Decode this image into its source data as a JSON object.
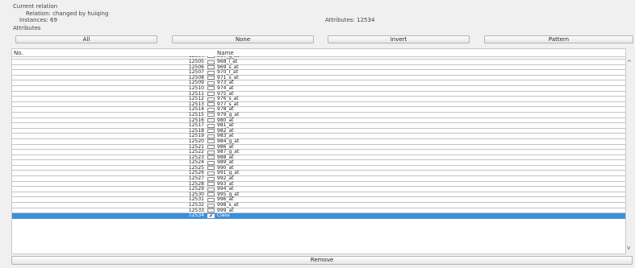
{
  "current_relation": {
    "heading": "Current relation",
    "relation": "Relation: changed by huiqing",
    "instances": "Instances: 69",
    "attributes_count": "Attributes: 12534"
  },
  "attributes_section": {
    "heading": "Attributes",
    "buttons": {
      "all": "All",
      "none": "None",
      "invert": "Invert",
      "pattern": "Pattern"
    }
  },
  "table": {
    "columns": [
      "No.",
      "Name"
    ],
    "partial_top_row": {
      "no": "12504",
      "name": "967_g_at"
    },
    "rows": [
      {
        "no": "12505",
        "name": "968_i_at"
      },
      {
        "no": "12506",
        "name": "969_s_at"
      },
      {
        "no": "12507",
        "name": "970_r_at"
      },
      {
        "no": "12508",
        "name": "971_s_at"
      },
      {
        "no": "12509",
        "name": "973_at"
      },
      {
        "no": "12510",
        "name": "974_at"
      },
      {
        "no": "12511",
        "name": "975_at"
      },
      {
        "no": "12512",
        "name": "976_s_at"
      },
      {
        "no": "12513",
        "name": "977_s_at"
      },
      {
        "no": "12514",
        "name": "978_at"
      },
      {
        "no": "12515",
        "name": "979_g_at"
      },
      {
        "no": "12516",
        "name": "980_at"
      },
      {
        "no": "12517",
        "name": "981_at"
      },
      {
        "no": "12518",
        "name": "982_at"
      },
      {
        "no": "12519",
        "name": "983_at"
      },
      {
        "no": "12520",
        "name": "984_g_at"
      },
      {
        "no": "12521",
        "name": "986_at"
      },
      {
        "no": "12522",
        "name": "987_g_at"
      },
      {
        "no": "12523",
        "name": "988_at"
      },
      {
        "no": "12524",
        "name": "989_at"
      },
      {
        "no": "12525",
        "name": "990_at"
      },
      {
        "no": "12526",
        "name": "991_g_at"
      },
      {
        "no": "12527",
        "name": "992_at"
      },
      {
        "no": "12528",
        "name": "993_at"
      },
      {
        "no": "12529",
        "name": "994_at"
      },
      {
        "no": "12530",
        "name": "995_g_at"
      },
      {
        "no": "12531",
        "name": "996_at"
      },
      {
        "no": "12532",
        "name": "998_s_at"
      },
      {
        "no": "12533",
        "name": "999_at"
      },
      {
        "no": "12534",
        "name": "Class",
        "checked": true,
        "selected": true
      }
    ]
  },
  "scroll": {
    "up": "^",
    "down": "v"
  },
  "remove_button": "Remove",
  "colors": {
    "selection": "#3d8fd9",
    "background": "#f0f0f0"
  }
}
